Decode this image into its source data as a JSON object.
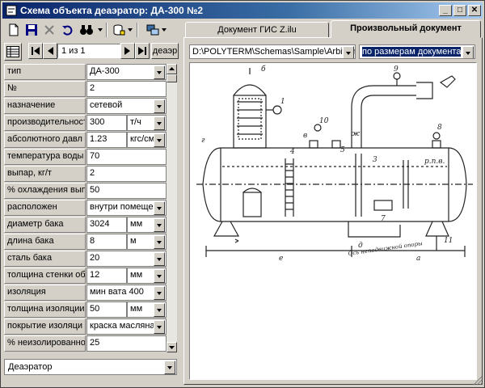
{
  "window": {
    "title": "Схема объекта деаэратор: ДА-300 №2"
  },
  "titlebar": {
    "min": "_",
    "max": "□",
    "close": "✕"
  },
  "nav": {
    "record": "1 из 1",
    "deaer_btn": "деаэр"
  },
  "props": [
    {
      "label": "тип",
      "value": "ДА-300",
      "dropdown": true
    },
    {
      "label": "№",
      "value": "2"
    },
    {
      "label": "назначение",
      "value": "сетевой",
      "dropdown": true
    },
    {
      "label": "производительност",
      "value": "300",
      "unit": "т/ч",
      "unit_dropdown": true
    },
    {
      "label": "абсолютного давл",
      "value": "1.23",
      "unit": "кгс/см",
      "unit_dropdown": true
    },
    {
      "label": "температура воды",
      "value": "70"
    },
    {
      "label": "выпар, кг/т",
      "value": "2"
    },
    {
      "label": "% охлаждения выпа",
      "value": "50"
    },
    {
      "label": "расположен",
      "value": "внутри помещен",
      "dropdown": true
    },
    {
      "label": "диаметр бака",
      "value": "3024",
      "unit": "мм",
      "unit_dropdown": true
    },
    {
      "label": "длина бака",
      "value": "8",
      "unit": "м",
      "unit_dropdown": true
    },
    {
      "label": "сталь бака",
      "value": "20",
      "dropdown": true
    },
    {
      "label": "толщина стенки об",
      "value": "12",
      "unit": "мм",
      "unit_dropdown": true
    },
    {
      "label": "изоляция",
      "value": "мин вата 400",
      "dropdown": true
    },
    {
      "label": "толщина изоляции",
      "value": "50",
      "unit": "мм",
      "unit_dropdown": true
    },
    {
      "label": "покрытие изоляци",
      "value": "краска масляна",
      "dropdown": true
    },
    {
      "label": "% неизолированной",
      "value": "25"
    }
  ],
  "bottom_combo": "Деаэратор",
  "tabs": [
    {
      "label": "Документ ГИС Z.ilu",
      "active": false
    },
    {
      "label": "Произвольный документ",
      "active": true
    }
  ],
  "path_combo": "D:\\POLYTERM\\Schemas\\Sample\\Arbitrar",
  "scale_combo": "по размерам документа",
  "drawing": {
    "labels": [
      "б",
      "1",
      "10",
      "4",
      "3",
      "8",
      "9",
      "5",
      "7",
      "11",
      "г",
      "в",
      "ж",
      "д",
      "е",
      "а",
      "р.п.в."
    ],
    "axis_note": "Ось неподвижной опоры"
  }
}
